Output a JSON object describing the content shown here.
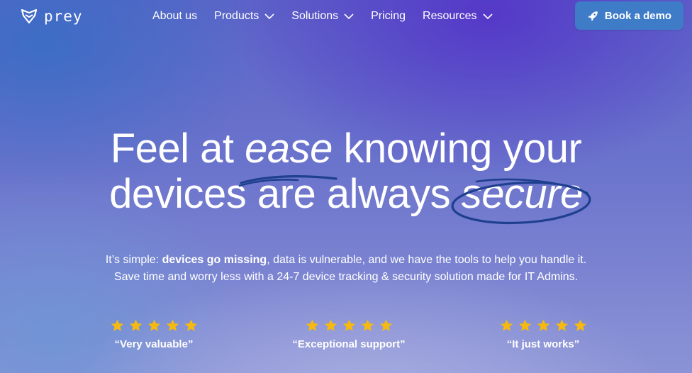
{
  "nav": {
    "logo_text": "prey",
    "items": [
      {
        "label": "About us",
        "has_dropdown": false
      },
      {
        "label": "Products",
        "has_dropdown": true
      },
      {
        "label": "Solutions",
        "has_dropdown": true
      },
      {
        "label": "Pricing",
        "has_dropdown": false
      },
      {
        "label": "Resources",
        "has_dropdown": true
      }
    ],
    "cta_label": "Book a demo",
    "cta_icon": "rocket-icon"
  },
  "hero": {
    "line1_pre": "Feel at ",
    "line1_em": "ease",
    "line1_post": " knowing your",
    "line2_pre": "devices are always ",
    "line2_em": "secure",
    "sub_line1_pre": "It’s simple: ",
    "sub_line1_bold": "devices go missing",
    "sub_line1_post": ", data is vulnerable, and we have the tools to help you handle it.",
    "sub_line2": "Save time and worry less with a 24-7 device tracking & security solution made for IT Admins."
  },
  "reviews": [
    {
      "stars": 5,
      "quote": "“Very valuable”"
    },
    {
      "stars": 5,
      "quote": "“Exceptional support”"
    },
    {
      "stars": 5,
      "quote": "“It just works”"
    }
  ],
  "colors": {
    "cta_bg": "#3f7cc8",
    "star": "#f5b90f",
    "scribble": "#1f3f8f"
  }
}
